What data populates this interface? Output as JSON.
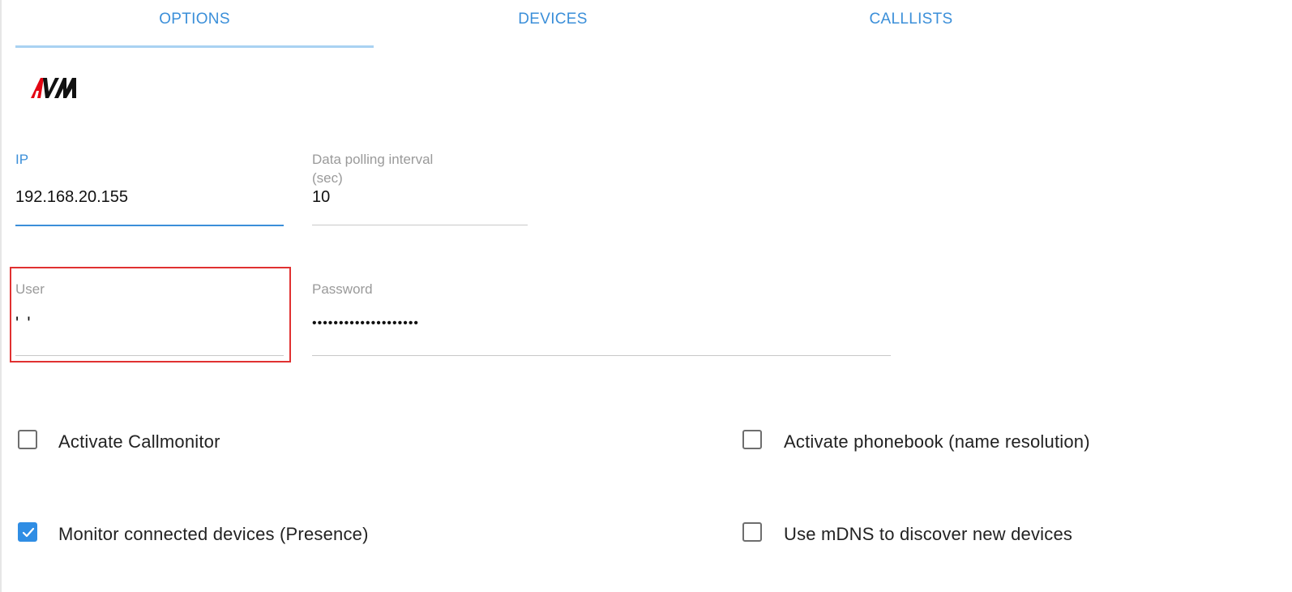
{
  "tabs": [
    {
      "label": "OPTIONS"
    },
    {
      "label": "DEVICES"
    },
    {
      "label": "CALLLISTS"
    }
  ],
  "active_tab": "OPTIONS",
  "logo": {
    "text": "AVM",
    "colors": {
      "a": "#e30613",
      "vm": "#111111"
    }
  },
  "fields": {
    "ip": {
      "label": "IP",
      "value": "192.168.20.155"
    },
    "polling": {
      "label_line1": "Data polling interval",
      "label_line2": "(sec)",
      "value": "10"
    },
    "user": {
      "label": "User",
      "value": "' '"
    },
    "password": {
      "label": "Password",
      "value": "••••••••••••••••••••"
    }
  },
  "checkboxes": {
    "callmonitor": {
      "label": "Activate Callmonitor",
      "checked": false
    },
    "phonebook": {
      "label": "Activate phonebook (name resolution)",
      "checked": false
    },
    "presence": {
      "label": "Monitor connected devices (Presence)",
      "checked": true
    },
    "mdns": {
      "label": "Use mDNS to discover new devices",
      "checked": false
    }
  },
  "colors": {
    "accent": "#3b8fd9",
    "checkbox_checked": "#2f8de4",
    "highlight_box": "#e03131"
  }
}
